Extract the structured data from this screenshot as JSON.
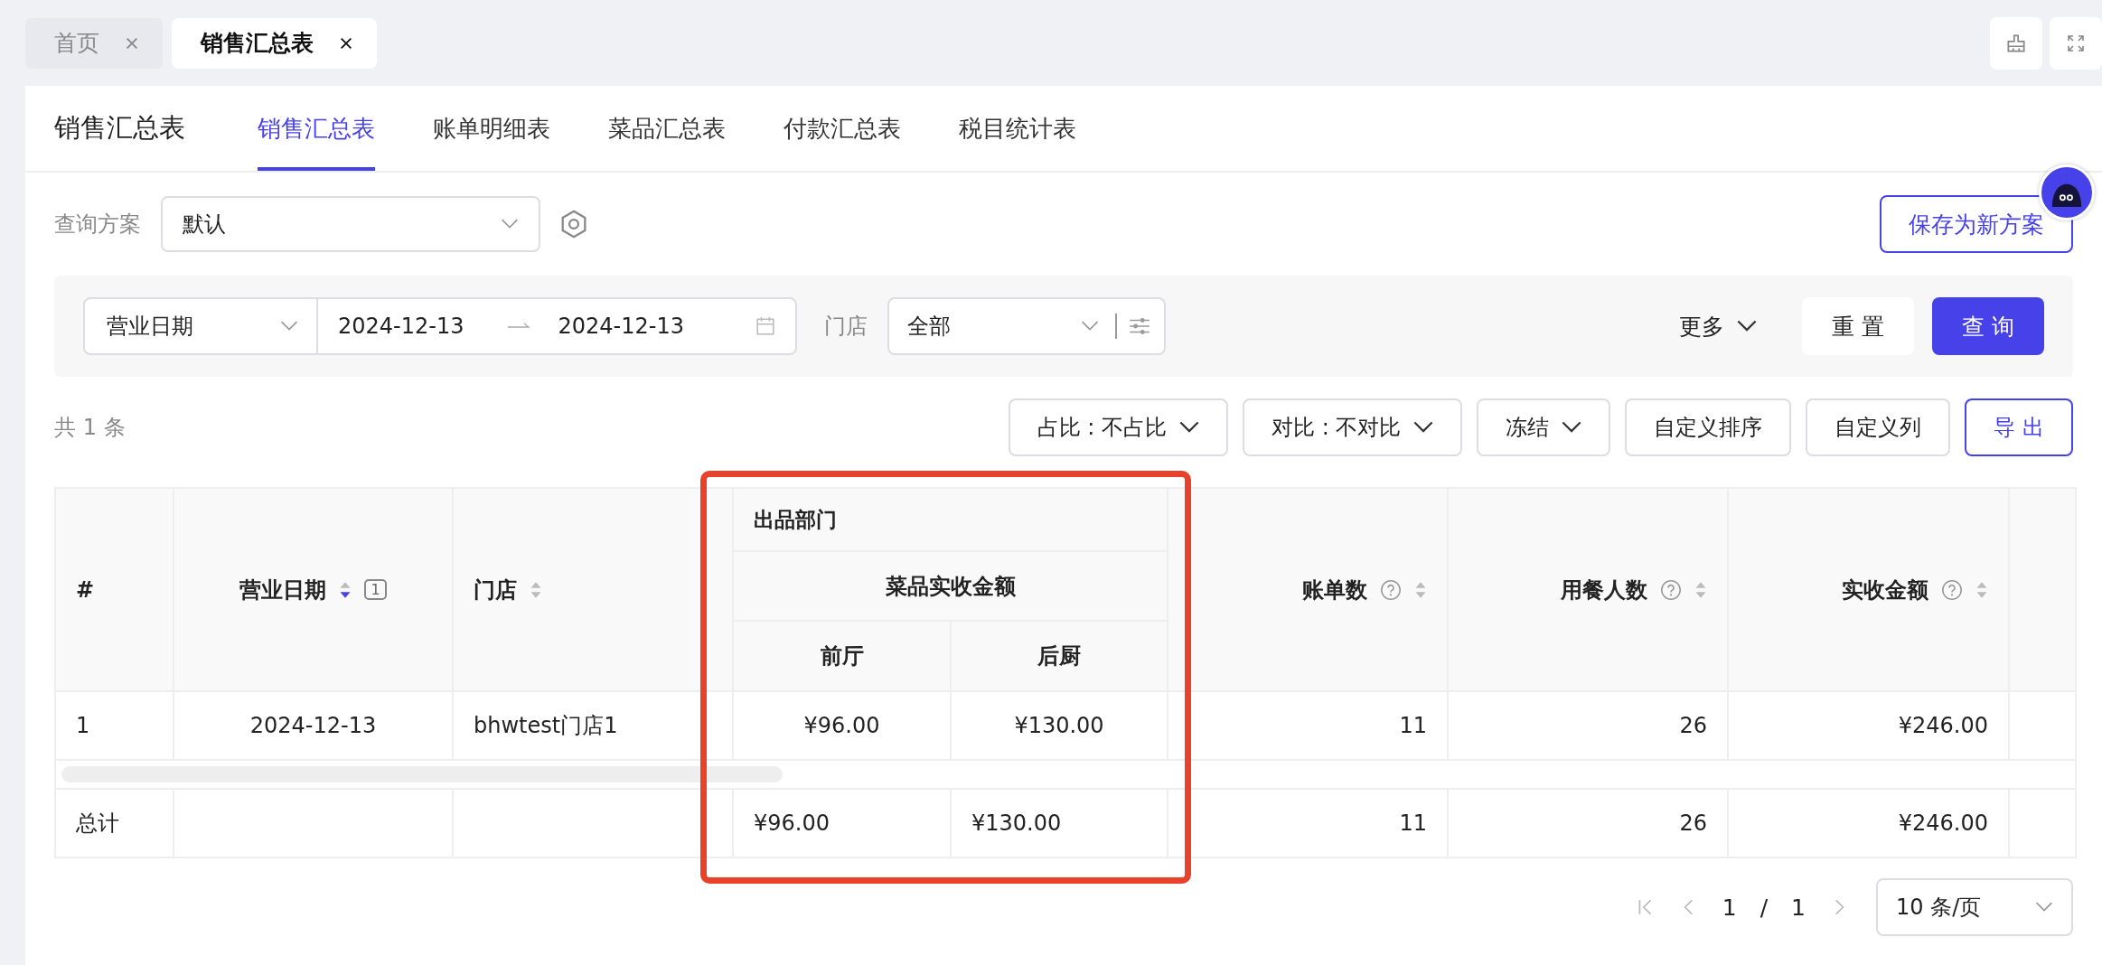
{
  "page_tabs": [
    {
      "label": "首页",
      "selected": false
    },
    {
      "label": "销售汇总表",
      "selected": true
    }
  ],
  "header": {
    "title": "销售汇总表",
    "tabs": [
      {
        "label": "销售汇总表",
        "selected": true
      },
      {
        "label": "账单明细表",
        "selected": false
      },
      {
        "label": "菜品汇总表",
        "selected": false
      },
      {
        "label": "付款汇总表",
        "selected": false
      },
      {
        "label": "税目统计表",
        "selected": false
      }
    ]
  },
  "query_scheme": {
    "label": "查询方案",
    "value": "默认",
    "save_button": "保存为新方案"
  },
  "filters": {
    "date_type": "营业日期",
    "start_date": "2024-12-13",
    "end_date": "2024-12-13",
    "store_label": "门店",
    "store_value": "全部",
    "more": "更多",
    "reset": "重 置",
    "search": "查 询"
  },
  "toolbar": {
    "count": "共 1 条",
    "buttons": [
      {
        "label": "占比 : 不占比",
        "kind": "dropdown"
      },
      {
        "label": "对比 : 不对比",
        "kind": "dropdown"
      },
      {
        "label": "冻结",
        "kind": "dropdown"
      },
      {
        "label": "自定义排序",
        "kind": "plain"
      },
      {
        "label": "自定义列",
        "kind": "plain"
      },
      {
        "label": "导 出",
        "kind": "primary"
      }
    ]
  },
  "table": {
    "group": "出品部门",
    "subgroup": "菜品实收金额",
    "columns": [
      {
        "label": "#",
        "kind": "index",
        "help": false,
        "sortable": false
      },
      {
        "label": "营业日期",
        "kind": "date",
        "help": false,
        "sortable": true,
        "sort_desc": true,
        "sort_order": "1"
      },
      {
        "label": "门店",
        "kind": "text",
        "help": false,
        "sortable": true,
        "sort_desc": false
      },
      {
        "label": "前厅",
        "kind": "split",
        "help": false,
        "sortable": false
      },
      {
        "label": "后厨",
        "kind": "split",
        "help": false,
        "sortable": false
      },
      {
        "label": "账单数",
        "kind": "number",
        "help": true,
        "sortable": true,
        "sort_desc": false
      },
      {
        "label": "用餐人数",
        "kind": "number",
        "help": true,
        "sortable": true,
        "sort_desc": false
      },
      {
        "label": "实收金额",
        "kind": "number",
        "help": true,
        "sortable": true,
        "sort_desc": false
      }
    ],
    "rows": [
      [
        "1",
        "2024-12-13",
        "bhwtest门店1",
        "¥96.00",
        "¥130.00",
        "11",
        "26",
        "¥246.00"
      ]
    ],
    "total": {
      "label": "总计",
      "values": [
        "¥96.00",
        "¥130.00",
        "11",
        "26",
        "¥246.00"
      ]
    }
  },
  "pagination": {
    "current": "1",
    "separator": "/",
    "total": "1",
    "page_size": "10 条/页"
  }
}
